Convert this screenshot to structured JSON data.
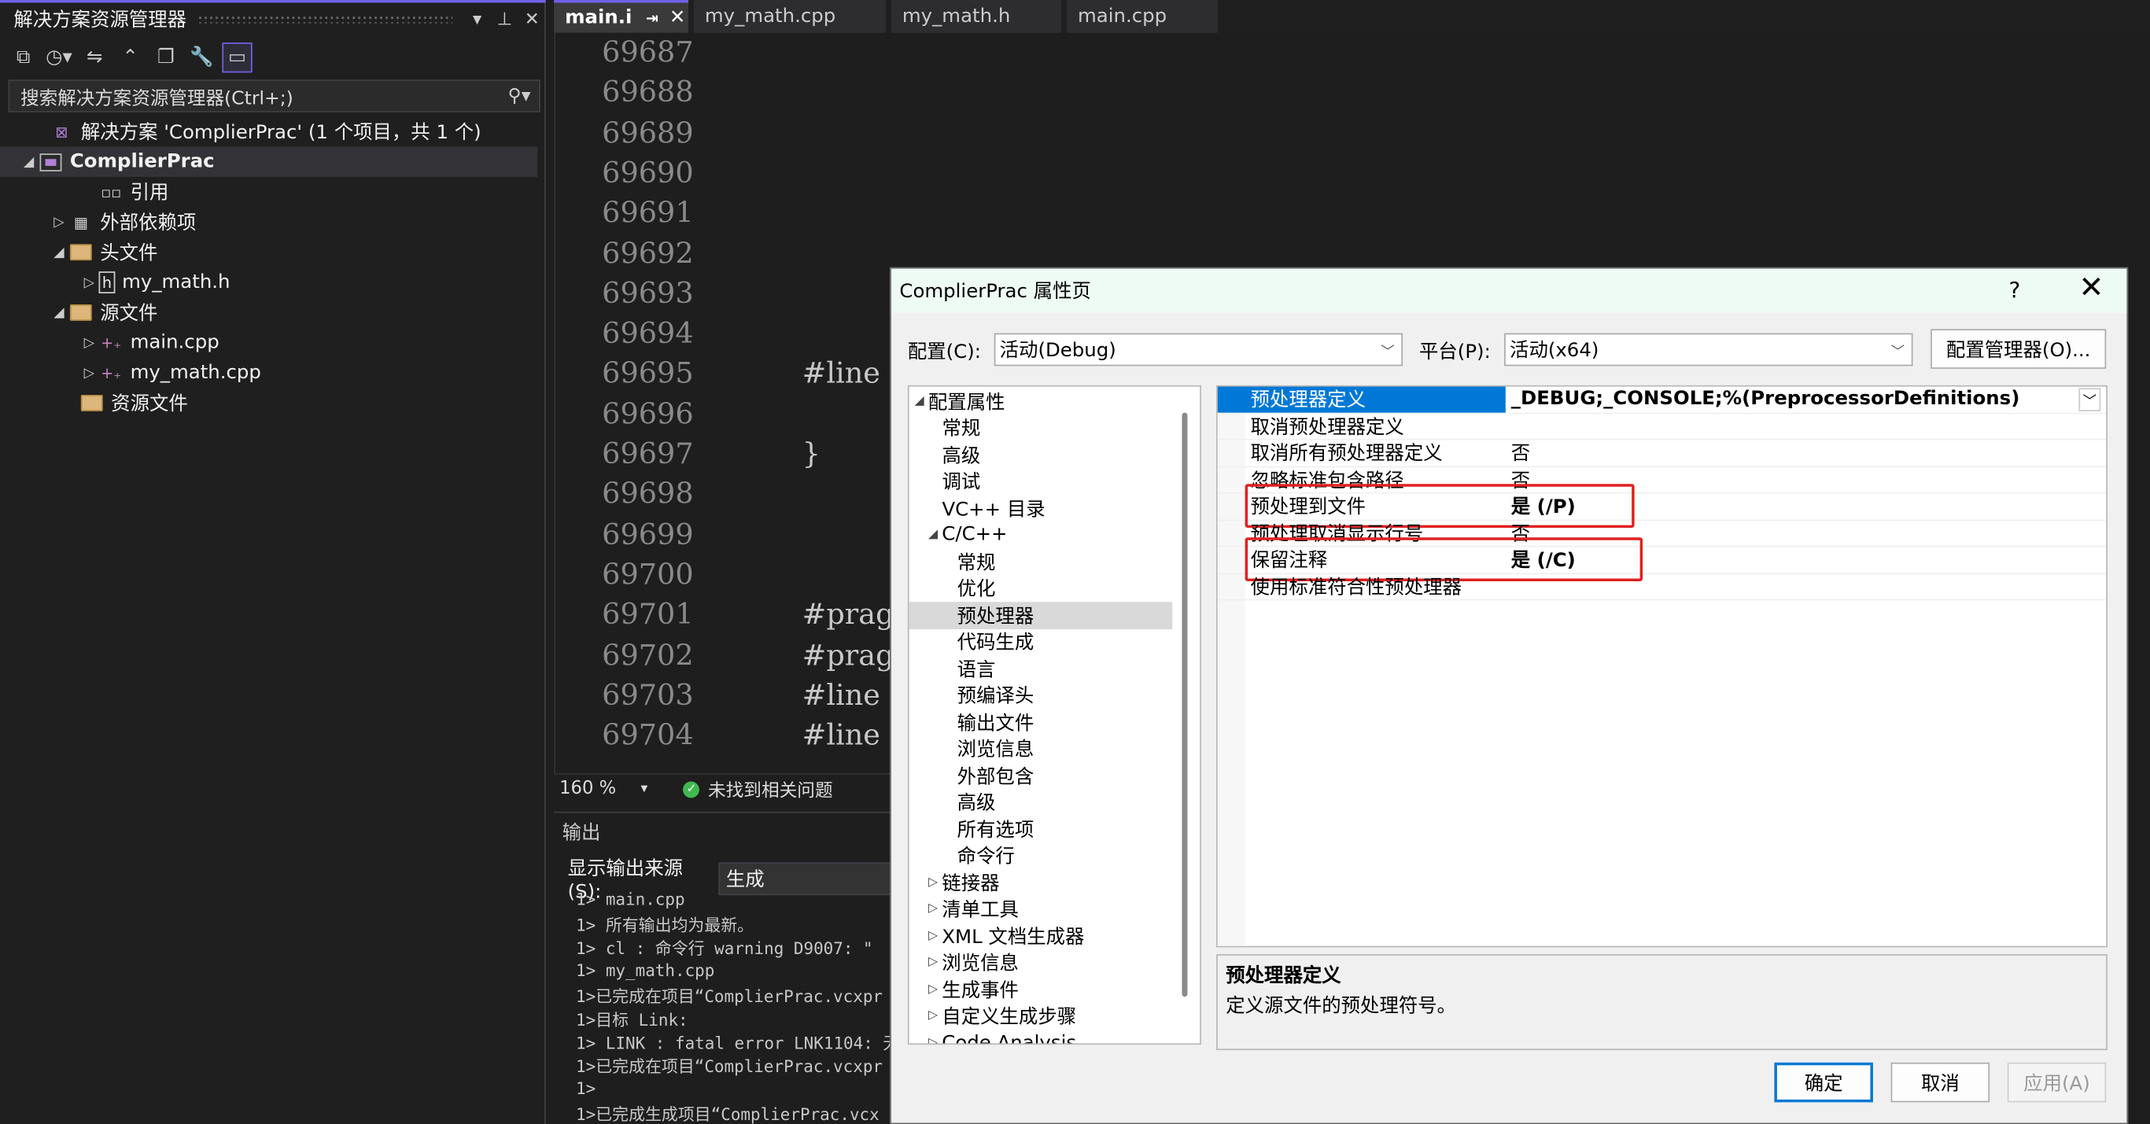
{
  "solution_explorer": {
    "title": "解决方案资源管理器",
    "search_placeholder": "搜索解决方案资源管理器(Ctrl+;)",
    "tree": [
      {
        "label": "解决方案 'ComplierPrac' (1 个项目，共 1 个)",
        "icon": "solution-icon"
      },
      {
        "label": "ComplierPrac",
        "icon": "project-icon"
      },
      {
        "label": "引用",
        "icon": "reference-icon"
      },
      {
        "label": "外部依赖项",
        "icon": "external-deps-icon"
      },
      {
        "label": "头文件",
        "icon": "folder-icon"
      },
      {
        "label": "my_math.h",
        "icon": "header-file-icon"
      },
      {
        "label": "源文件",
        "icon": "folder-icon"
      },
      {
        "label": "main.cpp",
        "icon": "cpp-file-icon"
      },
      {
        "label": "my_math.cpp",
        "icon": "cpp-file-icon"
      },
      {
        "label": "资源文件",
        "icon": "folder-icon"
      }
    ]
  },
  "editor": {
    "tabs": [
      {
        "label": "main.i",
        "active": true
      },
      {
        "label": "my_math.cpp"
      },
      {
        "label": "my_math.h"
      },
      {
        "label": "main.cpp"
      }
    ],
    "lines": [
      {
        "num": "69687",
        "code": ""
      },
      {
        "num": "69688",
        "code": ""
      },
      {
        "num": "69689",
        "code": ""
      },
      {
        "num": "69690",
        "code": ""
      },
      {
        "num": "69691",
        "code": ""
      },
      {
        "num": "69692",
        "code": ""
      },
      {
        "num": "69693",
        "code": ""
      },
      {
        "num": "69694",
        "code": ""
      },
      {
        "num": "69695",
        "code": "#line"
      },
      {
        "num": "69696",
        "code": ""
      },
      {
        "num": "69697",
        "code": "}"
      },
      {
        "num": "69698",
        "code": ""
      },
      {
        "num": "69699",
        "code": ""
      },
      {
        "num": "69700",
        "code": ""
      },
      {
        "num": "69701",
        "code": "#pragm"
      },
      {
        "num": "69702",
        "code": "#pragm"
      },
      {
        "num": "69703",
        "code": "#line"
      },
      {
        "num": "69704",
        "code": "#line"
      }
    ],
    "zoom": "160 %",
    "issues": "未找到相关问题"
  },
  "output": {
    "title": "输出",
    "source_label": "显示输出来源(S):",
    "source_value": "生成",
    "lines": [
      "1>  main.cpp",
      "1>  所有输出均为最新。",
      "1>  cl : 命令行  warning D9007: \"",
      "1>  my_math.cpp",
      "1>已完成在项目“ComplierPrac.vcxpr",
      "1>目标 Link:",
      "1>  LINK : fatal error LNK1104: 无",
      "1>已完成在项目“ComplierPrac.vcxpr",
      "1>",
      "1>已完成生成项目“ComplierPrac.vcx"
    ]
  },
  "dialog": {
    "title": "ComplierPrac 属性页",
    "help": "?",
    "config_label": "配置(C):",
    "config_value": "活动(Debug)",
    "platform_label": "平台(P):",
    "platform_value": "活动(x64)",
    "config_manager": "配置管理器(O)...",
    "tree": [
      {
        "label": "配置属性",
        "level": 0,
        "arrow": "◢"
      },
      {
        "label": "常规",
        "level": 1
      },
      {
        "label": "高级",
        "level": 1
      },
      {
        "label": "调试",
        "level": 1
      },
      {
        "label": "VC++ 目录",
        "level": 1
      },
      {
        "label": "C/C++",
        "level": 1,
        "arrow": "◢"
      },
      {
        "label": "常规",
        "level": 2
      },
      {
        "label": "优化",
        "level": 2
      },
      {
        "label": "预处理器",
        "level": 2,
        "selected": true
      },
      {
        "label": "代码生成",
        "level": 2
      },
      {
        "label": "语言",
        "level": 2
      },
      {
        "label": "预编译头",
        "level": 2
      },
      {
        "label": "输出文件",
        "level": 2
      },
      {
        "label": "浏览信息",
        "level": 2
      },
      {
        "label": "外部包含",
        "level": 2
      },
      {
        "label": "高级",
        "level": 2
      },
      {
        "label": "所有选项",
        "level": 2
      },
      {
        "label": "命令行",
        "level": 2
      },
      {
        "label": "链接器",
        "level": 1,
        "arrow": "▷"
      },
      {
        "label": "清单工具",
        "level": 1,
        "arrow": "▷"
      },
      {
        "label": "XML 文档生成器",
        "level": 1,
        "arrow": "▷"
      },
      {
        "label": "浏览信息",
        "level": 1,
        "arrow": "▷"
      },
      {
        "label": "生成事件",
        "level": 1,
        "arrow": "▷"
      },
      {
        "label": "自定义生成步骤",
        "level": 1,
        "arrow": "▷"
      },
      {
        "label": "Code Analysis",
        "level": 1,
        "arrow": "▷"
      }
    ],
    "properties": [
      {
        "name": "预处理器定义",
        "value": "_DEBUG;_CONSOLE;%(PreprocessorDefinitions)",
        "bold": true,
        "selected": true
      },
      {
        "name": "取消预处理器定义",
        "value": ""
      },
      {
        "name": "取消所有预处理器定义",
        "value": "否"
      },
      {
        "name": "忽略标准包含路径",
        "value": "否"
      },
      {
        "name": "预处理到文件",
        "value": "是 (/P)",
        "bold": true,
        "highlight": true
      },
      {
        "name": "预处理取消显示行号",
        "value": "否"
      },
      {
        "name": "保留注释",
        "value": "是 (/C)",
        "bold": true,
        "highlight": true
      },
      {
        "name": "使用标准符合性预处理器",
        "value": ""
      }
    ],
    "desc_title": "预处理器定义",
    "desc_text": "定义源文件的预处理符号。",
    "ok": "确定",
    "cancel": "取消",
    "apply": "应用(A)",
    "highlight_color": "#e02020",
    "selection_color": "#0078d7"
  }
}
